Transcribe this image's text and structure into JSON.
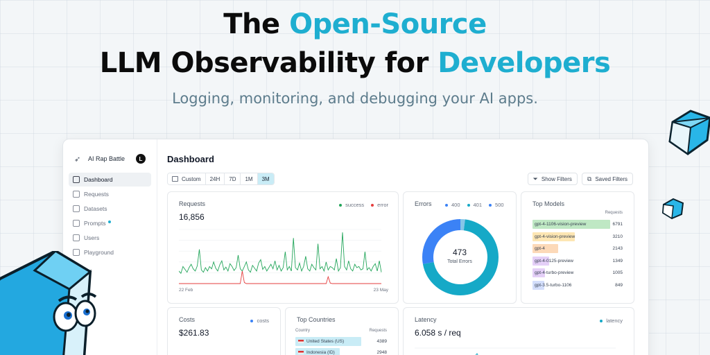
{
  "hero": {
    "line1_plain": "The ",
    "line1_accent": "Open-Source",
    "line2_plain": "LLM Observability for ",
    "line2_accent": "Developers",
    "tagline": "Logging, monitoring, and debugging your AI apps.",
    "accent_color": "#1eaed0"
  },
  "sidebar": {
    "project_name": "AI Rap Battle",
    "avatar_letter": "L",
    "items": [
      {
        "label": "Dashboard",
        "icon": "home-icon",
        "active": true
      },
      {
        "label": "Requests",
        "icon": "table-icon"
      },
      {
        "label": "Datasets",
        "icon": "folder-icon"
      },
      {
        "label": "Prompts",
        "icon": "document-icon",
        "badge": true
      },
      {
        "label": "Users",
        "icon": "user-icon"
      },
      {
        "label": "Playground",
        "icon": "flask-icon"
      }
    ]
  },
  "main": {
    "title": "Dashboard",
    "ranges": [
      "Custom",
      "24H",
      "7D",
      "1M",
      "3M"
    ],
    "active_range": "3M",
    "show_filters": "Show Filters",
    "saved_filters": "Saved Filters"
  },
  "requests": {
    "title": "Requests",
    "value": "16,856",
    "legend_success": "success",
    "legend_error": "error",
    "x_start": "22 Feb",
    "x_end": "23 May"
  },
  "errors": {
    "title": "Errors",
    "legend": [
      "400",
      "401",
      "500"
    ],
    "total": "473",
    "total_label": "Total Errors"
  },
  "top_models": {
    "title": "Top Models",
    "col_requests": "Requests",
    "rows": [
      {
        "name": "gpt-4-1106-vision-preview",
        "value": "6791",
        "color": "#bfe8c4",
        "fraction": 0.81
      },
      {
        "name": "gpt-4-vision-preview",
        "value": "3210",
        "color": "#fde6b3",
        "fraction": 0.44
      },
      {
        "name": "gpt-4",
        "value": "2143",
        "color": "#fcd9b8",
        "fraction": 0.27
      },
      {
        "name": "gpt-4-0125-preview",
        "value": "1349",
        "color": "#e4cff7",
        "fraction": 0.17
      },
      {
        "name": "gpt-4-turbo-preview",
        "value": "1005",
        "color": "#e4cff7",
        "fraction": 0.13
      },
      {
        "name": "gpt-3.5-turbo-1106",
        "value": "849",
        "color": "#d3defb",
        "fraction": 0.12
      }
    ]
  },
  "costs": {
    "title": "Costs",
    "value": "$261.83",
    "legend": "costs"
  },
  "top_countries": {
    "title": "Top Countries",
    "col_country": "Country",
    "col_requests": "Requests",
    "rows": [
      {
        "name": "United States (US)",
        "value": "4389",
        "fraction": 0.77
      },
      {
        "name": "Indonesia (ID)",
        "value": "2948",
        "fraction": 0.52
      }
    ]
  },
  "latency": {
    "title": "Latency",
    "value": "6.058 s / req",
    "legend": "latency"
  },
  "chart_data": {
    "type": "line",
    "title": "Requests",
    "x_start": "22 Feb",
    "x_end": "23 May",
    "series": [
      {
        "name": "success",
        "color": "#22a55a",
        "values": [
          22,
          18,
          30,
          25,
          20,
          28,
          34,
          26,
          22,
          31,
          60,
          24,
          20,
          28,
          22,
          30,
          26,
          38,
          27,
          22,
          33,
          40,
          24,
          29,
          22,
          35,
          30,
          23,
          28,
          50,
          26,
          22,
          30,
          38,
          24,
          20,
          32,
          27,
          22,
          36,
          42,
          25,
          30,
          22,
          28,
          34,
          26,
          40,
          24,
          32,
          22,
          28,
          56,
          24,
          30,
          22,
          80,
          28,
          24,
          36,
          22,
          30,
          48,
          26,
          22,
          34,
          28,
          24,
          70,
          26,
          30,
          22,
          38,
          24,
          30,
          28,
          24,
          44,
          22,
          28,
          90,
          30,
          24,
          40,
          26,
          22,
          34,
          28,
          30,
          24,
          26,
          56,
          24,
          28,
          22,
          30,
          35,
          22,
          40,
          20
        ]
      },
      {
        "name": "error",
        "color": "#e53e3e",
        "values": [
          0,
          0,
          0,
          0,
          0,
          0,
          0,
          0,
          0,
          0,
          0,
          0,
          0,
          0,
          0,
          0,
          0,
          0,
          0,
          0,
          0,
          0,
          0,
          0,
          0,
          0,
          0,
          0,
          0,
          0,
          0,
          22,
          2,
          0,
          0,
          0,
          0,
          0,
          0,
          0,
          0,
          0,
          0,
          0,
          0,
          0,
          0,
          0,
          0,
          0,
          0,
          0,
          0,
          0,
          0,
          0,
          0,
          0,
          0,
          0,
          0,
          0,
          0,
          0,
          0,
          0,
          0,
          0,
          0,
          0,
          0,
          0,
          0,
          12,
          1,
          0,
          0,
          0,
          0,
          0,
          0,
          0,
          0,
          0,
          0,
          0,
          0,
          0,
          0,
          0,
          0,
          0,
          0,
          0,
          0,
          0,
          0,
          0,
          0,
          0
        ]
      }
    ]
  },
  "error_donut": {
    "type": "pie",
    "categories": [
      "400",
      "401",
      "500"
    ],
    "values": [
      2,
      70,
      28
    ],
    "colors": [
      "#86c5e8",
      "#15a9c7",
      "#3b82f6"
    ]
  }
}
